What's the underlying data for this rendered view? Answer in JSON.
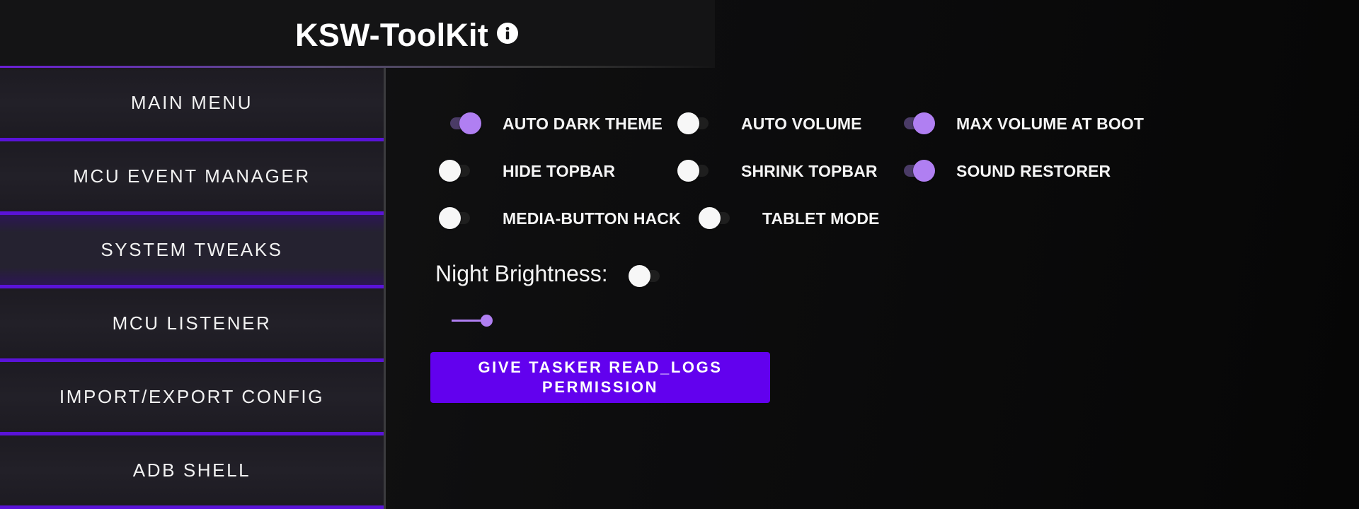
{
  "header": {
    "title": "KSW-ToolKit",
    "info_icon": "info-icon"
  },
  "sidebar": {
    "items": [
      {
        "label": "MAIN MENU",
        "active": false
      },
      {
        "label": "MCU EVENT MANAGER",
        "active": false
      },
      {
        "label": "SYSTEM TWEAKS",
        "active": true
      },
      {
        "label": "MCU LISTENER",
        "active": false
      },
      {
        "label": "IMPORT/EXPORT CONFIG",
        "active": false
      },
      {
        "label": "ADB SHELL",
        "active": false
      }
    ]
  },
  "tweaks": {
    "options": [
      {
        "label": "AUTO DARK THEME",
        "on": true
      },
      {
        "label": "AUTO VOLUME",
        "on": false
      },
      {
        "label": "MAX VOLUME AT BOOT",
        "on": true
      },
      {
        "label": "HIDE TOPBAR",
        "on": false
      },
      {
        "label": "SHRINK TOPBAR",
        "on": false
      },
      {
        "label": "SOUND RESTORER",
        "on": true
      },
      {
        "label": "MEDIA-BUTTON HACK",
        "on": false
      },
      {
        "label": "TABLET MODE",
        "on": false
      }
    ],
    "night_brightness": {
      "label": "Night Brightness:",
      "enabled": false,
      "slider_value": 0.7
    },
    "permission_button": {
      "label": "GIVE TASKER READ_LOGS PERMISSION"
    }
  },
  "colors": {
    "accent": "#6201ee",
    "toggle_on": "#b07ff2",
    "nav_divider": "#5a13d8",
    "background": "#0c0c0d"
  }
}
